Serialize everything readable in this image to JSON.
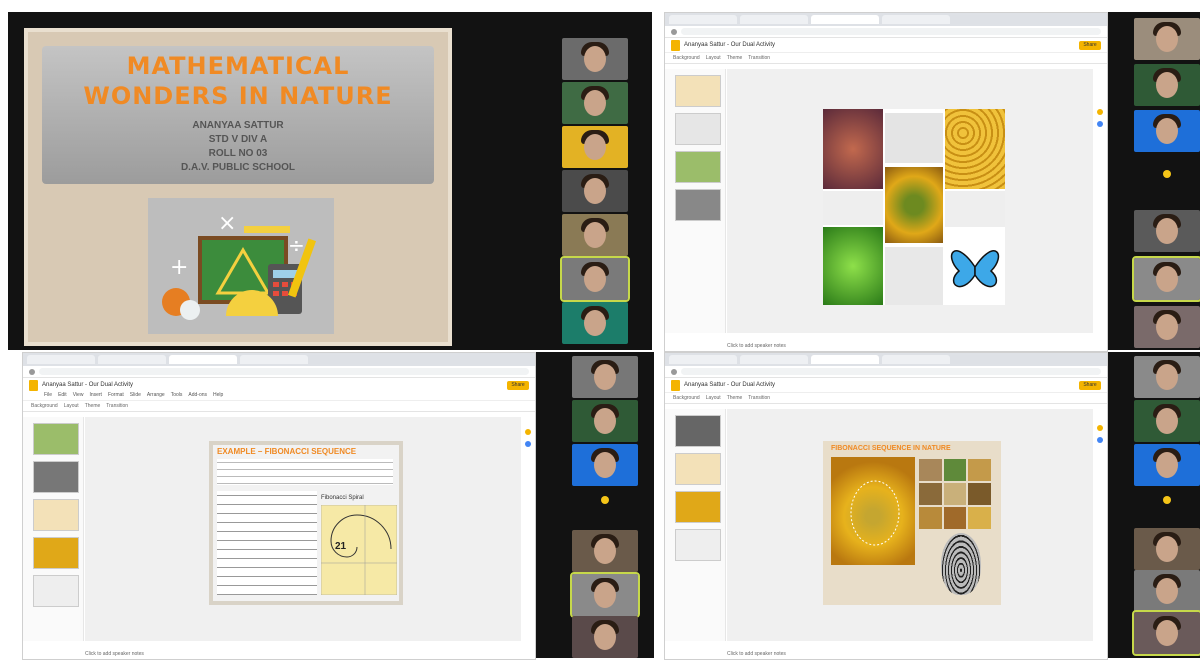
{
  "title_slide": {
    "title_line1": "MATHEMATICAL",
    "title_line2": "WONDERS IN NATURE",
    "author": "ANANYAA SATTUR",
    "class": "STD V DIV A",
    "roll": "ROLL NO 03",
    "school": "D.A.V. PUBLIC SCHOOL"
  },
  "slides_window": {
    "doc_title": "Ananyaa Sattur - Our Dual Activity",
    "share_label": "Share",
    "menu": [
      "File",
      "Edit",
      "View",
      "Insert",
      "Format",
      "Slide",
      "Arrange",
      "Tools",
      "Add-ons",
      "Help"
    ],
    "toolbar": [
      "Background",
      "Layout",
      "Theme",
      "Transition"
    ],
    "notes_placeholder": "Click to add speaker notes"
  },
  "slide_fibonacci": {
    "title": "EXAMPLE – FIBONACCI SEQUENCE",
    "spiral_label": "Fibonacci Spiral",
    "spiral_number": "21"
  },
  "slide_sunflower": {
    "title": "FIBONACCI SEQUENCE IN NATURE"
  },
  "colors": {
    "title_orange": "#f08a24",
    "highlight": "#c6d84a",
    "docs_yellow": "#f4b400"
  }
}
